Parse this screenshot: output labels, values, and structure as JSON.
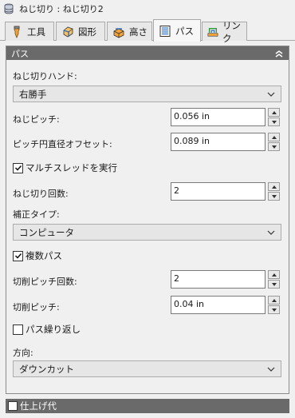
{
  "window": {
    "title": "ねじ切り : ねじ切り2",
    "icon": "database-stack-icon"
  },
  "tabs": [
    {
      "label": "工具",
      "icon": "tool-holder-icon",
      "active": false
    },
    {
      "label": "図形",
      "icon": "geometry-cube-icon",
      "active": false
    },
    {
      "label": "高さ",
      "icon": "heights-block-icon",
      "active": false
    },
    {
      "label": "パス",
      "icon": "passes-list-icon",
      "active": true
    },
    {
      "label": "リンク",
      "icon": "linking-icon",
      "active": false
    }
  ],
  "section": {
    "title": "パス",
    "threading_hand": {
      "label": "ねじ切りハンド:",
      "value": "右勝手"
    },
    "thread_pitch": {
      "label": "ねじピッチ:",
      "value": "0.056 in"
    },
    "pitch_offset": {
      "label": "ピッチ円直径オフセット:",
      "value": "0.089 in"
    },
    "multiple_threads": {
      "label": "マルチスレッドを実行",
      "checked": true
    },
    "thread_count": {
      "label": "ねじ切り回数:",
      "value": "2"
    },
    "compensation": {
      "label": "補正タイプ:",
      "value": "コンピュータ"
    },
    "multiple_passes": {
      "label": "複数パス",
      "checked": true
    },
    "pass_count": {
      "label": "切削ピッチ回数:",
      "value": "2"
    },
    "cut_pitch": {
      "label": "切削ピッチ:",
      "value": "0.04 in"
    },
    "repeat_pass": {
      "label": "パス繰り返し",
      "checked": false
    },
    "direction": {
      "label": "方向:",
      "value": "ダウンカット"
    }
  },
  "footer_section": {
    "label": "仕上げ代",
    "checked": false
  },
  "colors": {
    "header_bg": "#6a6a6a",
    "accent_blue": "#2e6fc1",
    "orange": "#f2a33a"
  }
}
